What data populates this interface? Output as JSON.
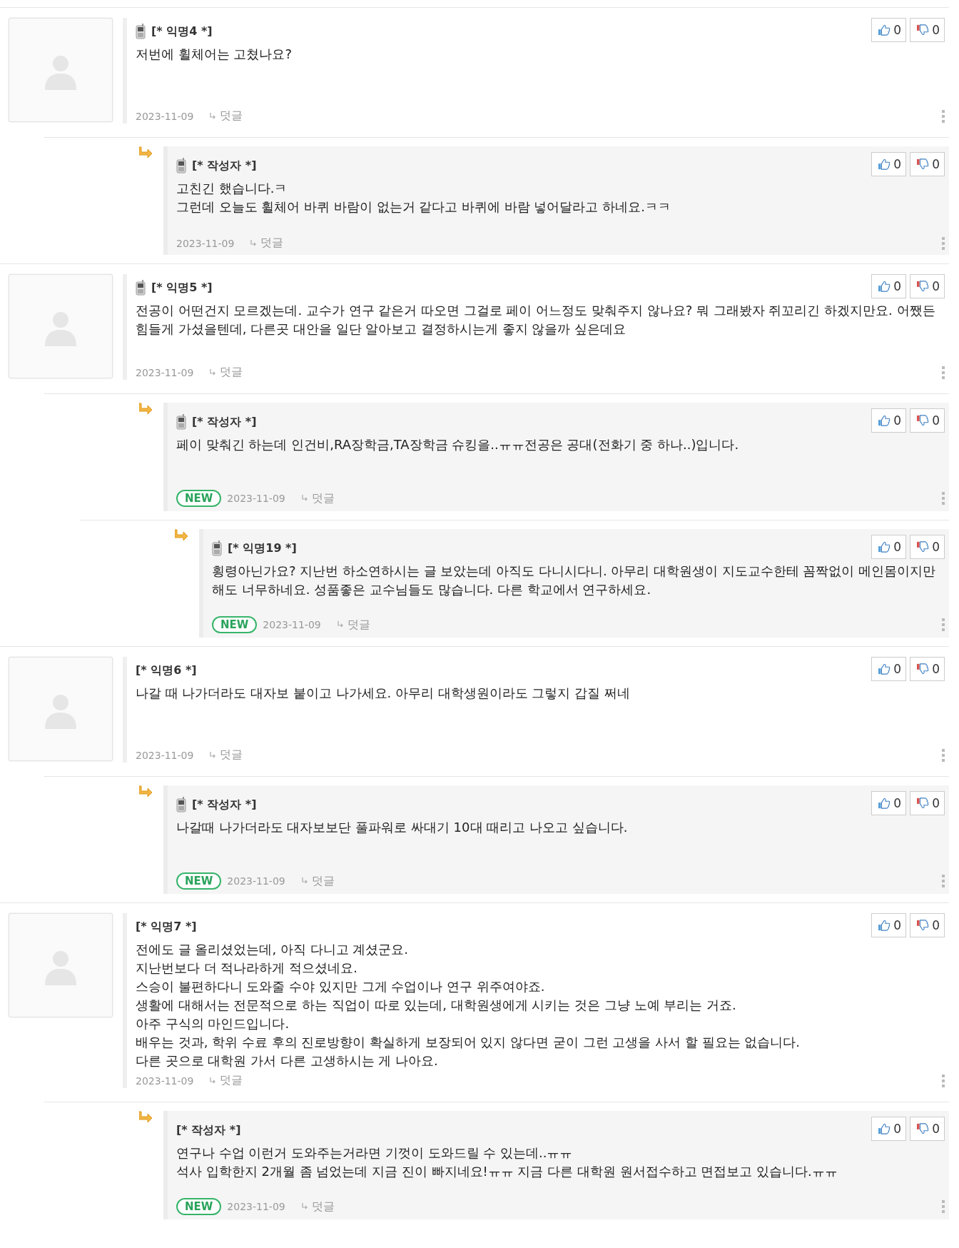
{
  "comments": [
    {
      "author": "[* 익명4 *]",
      "mobile": true,
      "lines": [
        "저번에 휠체어는 고쳤나요?"
      ],
      "date": "2023-11-09",
      "reply_label": "덧글",
      "likes": "0",
      "dislikes": "0",
      "children": [
        {
          "author": "[* 작성자 *]",
          "mobile": true,
          "lines": [
            "고친긴 했습니다.ㅋ",
            "그런데 오늘도 휠체어 바퀴 바람이 없는거 같다고 바퀴에 바람 넣어달라고 하네요.ㅋㅋ"
          ],
          "date": "2023-11-09",
          "reply_label": "덧글",
          "likes": "0",
          "dislikes": "0"
        }
      ]
    },
    {
      "author": "[* 익명5 *]",
      "mobile": true,
      "lines": [
        "전공이 어떤건지 모르겠는데. 교수가 연구 같은거 따오면 그걸로 페이 어느정도 맞춰주지 않나요? 뭐 그래봤자 쥐꼬리긴 하겠지만요. 어쨌든 힘들게 가셨을텐데, 다른곳 대안을 일단 알아보고 결정하시는게 좋지 않을까 싶은데요"
      ],
      "date": "2023-11-09",
      "reply_label": "덧글",
      "likes": "0",
      "dislikes": "0",
      "children": [
        {
          "author": "[* 작성자 *]",
          "mobile": true,
          "lines": [
            "페이 맞춰긴 하는데 인건비,RA장학금,TA장학금 슈킹을..ㅠㅠ전공은 공대(전화기 중 하나..)입니다."
          ],
          "badge": "NEW",
          "date": "2023-11-09",
          "reply_label": "덧글",
          "likes": "0",
          "dislikes": "0",
          "children": [
            {
              "author": "[* 익명19 *]",
              "mobile": true,
              "lines": [
                "횡령아닌가요? 지난번 하소연하시는 글 보았는데 아직도 다니시다니. 아무리 대학원생이 지도교수한테 꼼짝없이 메인몸이지만 해도 너무하네요. 성품좋은 교수님들도 많습니다. 다른 학교에서 연구하세요."
              ],
              "badge": "NEW",
              "date": "2023-11-09",
              "reply_label": "덧글",
              "likes": "0",
              "dislikes": "0"
            }
          ]
        }
      ]
    },
    {
      "author": "[* 익명6 *]",
      "mobile": false,
      "lines": [
        "나갈 때 나가더라도 대자보 붙이고 나가세요. 아무리 대학생원이라도 그렇지 갑질 쩌네"
      ],
      "date": "2023-11-09",
      "reply_label": "덧글",
      "likes": "0",
      "dislikes": "0",
      "children": [
        {
          "author": "[* 작성자 *]",
          "mobile": true,
          "lines": [
            "나갈때 나가더라도 대자보보단 풀파워로 싸대기 10대 때리고 나오고 싶습니다."
          ],
          "badge": "NEW",
          "date": "2023-11-09",
          "reply_label": "덧글",
          "likes": "0",
          "dislikes": "0"
        }
      ]
    },
    {
      "author": "[* 익명7 *]",
      "mobile": false,
      "lines": [
        "전에도 글 올리셨었는데, 아직 다니고 계셨군요.",
        "지난번보다 더 적나라하게 적으셨네요.",
        "스승이 불편하다니 도와줄 수야 있지만 그게 수업이나 연구 위주여야죠.",
        "생활에 대해서는 전문적으로 하는 직업이 따로 있는데, 대학원생에게 시키는 것은 그냥 노예 부리는 거죠.",
        "아주 구식의 마인드입니다.",
        "배우는 것과, 학위 수료 후의 진로방향이 확실하게 보장되어 있지 않다면 굳이 그런 고생을 사서 할 필요는 없습니다.",
        "다른 곳으로 대학원 가서 다른 고생하시는 게 나아요."
      ],
      "date": "2023-11-09",
      "reply_label": "덧글",
      "likes": "0",
      "dislikes": "0",
      "children": [
        {
          "author": "[* 작성자 *]",
          "mobile": false,
          "lines": [
            "연구나 수업 이런거 도와주는거라면 기껏이 도와드릴 수 있는데..ㅠㅠ",
            "석사 입학한지 2개월 좀 넘었는데 지금 진이 빠지네요!ㅠㅠ 지금 다른 대학원 원서접수하고 면접보고 있습니다.ㅠㅠ"
          ],
          "badge": "NEW",
          "date": "2023-11-09",
          "reply_label": "덧글",
          "likes": "0",
          "dislikes": "0"
        }
      ]
    }
  ]
}
